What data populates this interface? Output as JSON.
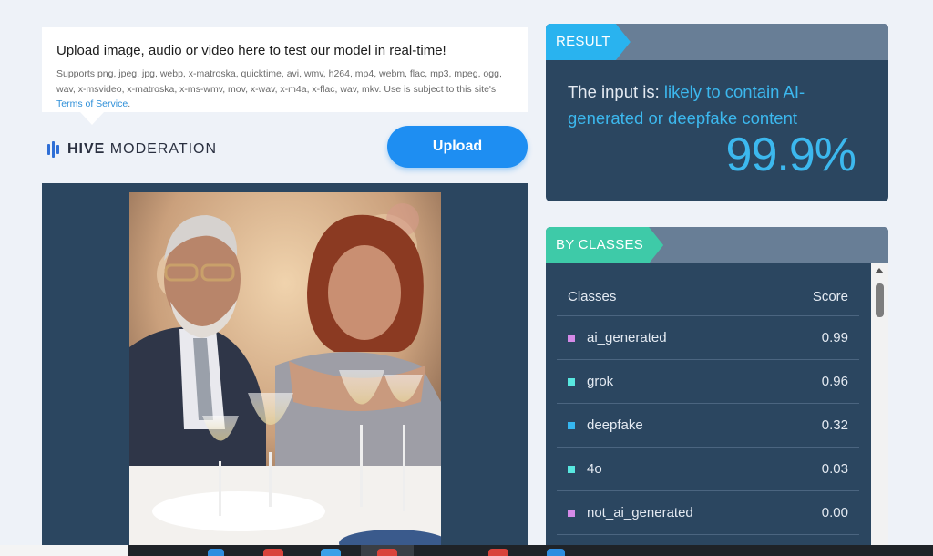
{
  "upload_panel": {
    "title": "Upload image, audio or video here to test our model in real-time!",
    "supports_text": "Supports png, jpeg, jpg, webp, x-matroska, quicktime, avi, wmv, h264, mp4, webm, flac, mp3, mpeg, ogg, wav, x-msvideo, x-matroska, x-ms-wmv, mov, x-wav, x-m4a, x-flac, wav, mkv. Use is subject to this site's",
    "tos_link": "Terms of Service",
    "tos_suffix": "."
  },
  "logo": {
    "bold": "HIVE",
    "rest": "MODERATION"
  },
  "upload_button": {
    "label": "Upload"
  },
  "result": {
    "tag": "RESULT",
    "prefix": "The input is:",
    "verdict": "likely to contain AI-generated or deepfake content",
    "percentage": "99.9%"
  },
  "by_classes": {
    "tag": "BY CLASSES",
    "headers": {
      "classes": "Classes",
      "score": "Score"
    },
    "rows": [
      {
        "name": "ai_generated",
        "score": "0.99",
        "color": "#d58ae8"
      },
      {
        "name": "grok",
        "score": "0.96",
        "color": "#58e8e0"
      },
      {
        "name": "deepfake",
        "score": "0.32",
        "color": "#35b6f0"
      },
      {
        "name": "4o",
        "score": "0.03",
        "color": "#58e8e0"
      },
      {
        "name": "not_ai_generated",
        "score": "0.00",
        "color": "#d58ae8"
      }
    ]
  },
  "colors": {
    "accent_blue": "#1e8ef2",
    "card_bg": "#2b4660",
    "highlight": "#3cb8ee",
    "tag_blue": "#29b3ef",
    "tag_green": "#3ecaa8"
  }
}
